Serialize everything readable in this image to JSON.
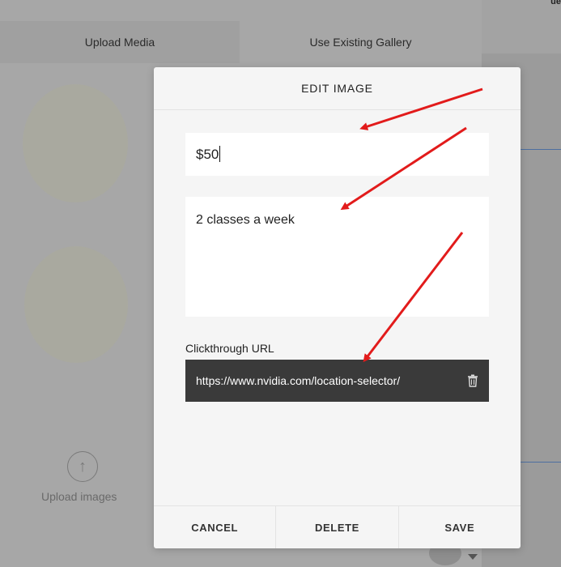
{
  "background": {
    "tabs": {
      "upload_media": "Upload Media",
      "use_existing_gallery": "Use Existing Gallery"
    },
    "upload_images_label": "Upload images",
    "upload_icon": "arrow-up-circle-icon",
    "corner_text": "ue"
  },
  "modal": {
    "title": "EDIT IMAGE",
    "title_field_value": "$50",
    "description_value": "2 classes a week",
    "clickthrough_label": "Clickthrough URL",
    "clickthrough_url": "https://www.nvidia.com/location-selector/",
    "trash_icon": "trash-icon",
    "buttons": {
      "cancel": "CANCEL",
      "delete": "DELETE",
      "save": "SAVE"
    }
  },
  "colors": {
    "annotation_arrow": "#e21b1b",
    "url_field_bg": "#3a3a3a",
    "modal_bg": "#f5f5f5"
  }
}
